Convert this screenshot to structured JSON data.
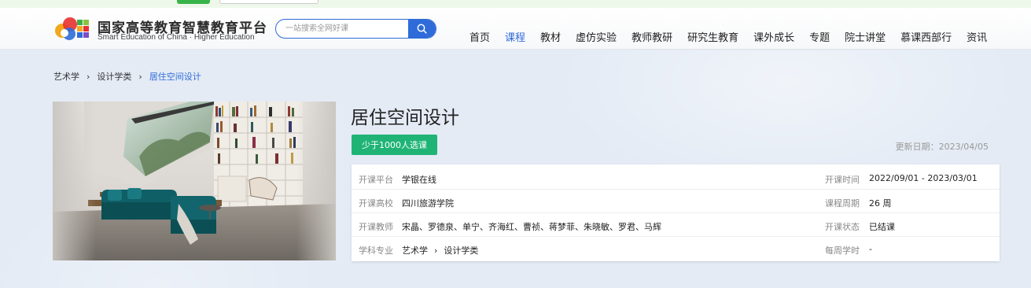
{
  "header": {
    "brand_cn": "国家高等教育智慧教育平台",
    "brand_en": "Smart Education of China · Higher Education",
    "search_placeholder": "一站搜索全网好课",
    "nav": [
      {
        "label": "首页",
        "active": false
      },
      {
        "label": "课程",
        "active": true
      },
      {
        "label": "教材",
        "active": false
      },
      {
        "label": "虚仿实验",
        "active": false
      },
      {
        "label": "教师教研",
        "active": false
      },
      {
        "label": "研究生教育",
        "active": false
      },
      {
        "label": "课外成长",
        "active": false
      },
      {
        "label": "专题",
        "active": false
      },
      {
        "label": "院士讲堂",
        "active": false
      },
      {
        "label": "慕课西部行",
        "active": false
      },
      {
        "label": "资讯",
        "active": false
      }
    ]
  },
  "breadcrumb": {
    "level1": "艺术学",
    "level2": "设计学类",
    "current": "居住空间设计",
    "separator": "›"
  },
  "course": {
    "title": "居住空间设计",
    "enroll_badge": "少于1000人选课",
    "update_date": "更新日期：2023/04/05",
    "info": {
      "platform_label": "开课平台",
      "platform": "学银在线",
      "school_label": "开课高校",
      "school": "四川旅游学院",
      "teachers_label": "开课教师",
      "teachers": "宋晶、罗德泉、单宁、齐海红、曹祯、蒋梦菲、朱晓敏、罗君、马辉",
      "subject_label": "学科专业",
      "subject_1": "艺术学",
      "subject_sep": "›",
      "subject_2": "设计学类",
      "time_label": "开课时间",
      "time": "2022/09/01 - 2023/03/01",
      "period_label": "课程周期",
      "period": "26 周",
      "status_label": "开课状态",
      "status": "已结课",
      "weekly_label": "每周学时",
      "weekly": "-"
    }
  },
  "colors": {
    "accent": "#2f6bd9",
    "badge_green": "#1fb476",
    "page_bg": "#e4ebf5"
  }
}
